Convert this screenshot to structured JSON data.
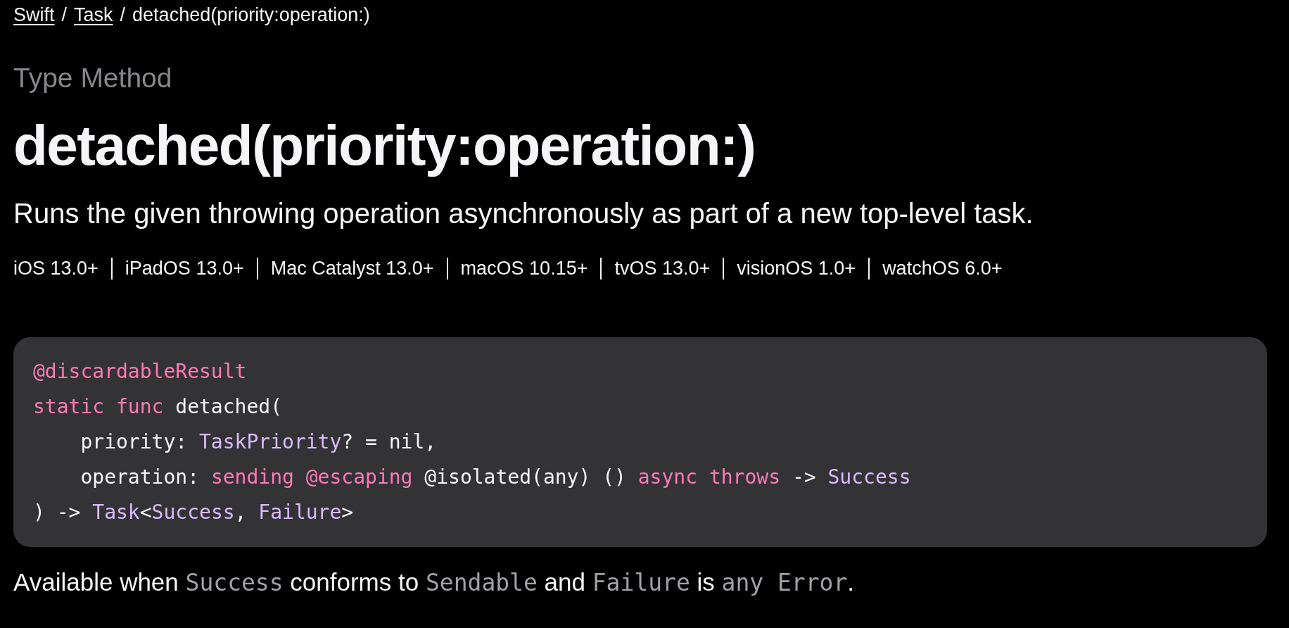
{
  "breadcrumbs": [
    {
      "label": "Swift",
      "link": true
    },
    {
      "label": "Task",
      "link": true
    },
    {
      "label": "detached(priority:operation:)",
      "link": false
    }
  ],
  "breadcrumb_separators": [
    "/",
    "/"
  ],
  "eyebrow": "Type Method",
  "title": "detached(priority:operation:)",
  "abstract": "Runs the given throwing operation asynchronously as part of a new top-level task.",
  "platforms": [
    "iOS 13.0+",
    "iPadOS 13.0+",
    "Mac Catalyst 13.0+",
    "macOS 10.15+",
    "tvOS 13.0+",
    "visionOS 1.0+",
    "watchOS 6.0+"
  ],
  "declaration": [
    [
      {
        "kind": "attribute",
        "text": "@discardableResult"
      }
    ],
    [
      {
        "kind": "keyword",
        "text": "static func"
      },
      {
        "kind": "plain",
        "text": " detached("
      }
    ],
    [
      {
        "kind": "plain",
        "text": "    priority: "
      },
      {
        "kind": "type",
        "text": "TaskPriority"
      },
      {
        "kind": "plain",
        "text": "? = nil,"
      }
    ],
    [
      {
        "kind": "plain",
        "text": "    operation: "
      },
      {
        "kind": "keyword",
        "text": "sending @escaping"
      },
      {
        "kind": "plain",
        "text": " @isolated(any) () "
      },
      {
        "kind": "keyword",
        "text": "async throws"
      },
      {
        "kind": "plain",
        "text": " -> "
      },
      {
        "kind": "type",
        "text": "Success"
      }
    ],
    [
      {
        "kind": "plain",
        "text": ") -> "
      },
      {
        "kind": "type",
        "text": "Task"
      },
      {
        "kind": "plain",
        "text": "<"
      },
      {
        "kind": "type",
        "text": "Success"
      },
      {
        "kind": "plain",
        "text": ", "
      },
      {
        "kind": "type",
        "text": "Failure"
      },
      {
        "kind": "plain",
        "text": ">"
      }
    ]
  ],
  "availability": [
    {
      "kind": "text",
      "text": "Available when "
    },
    {
      "kind": "code",
      "text": "Success"
    },
    {
      "kind": "text",
      "text": " conforms to "
    },
    {
      "kind": "code",
      "text": "Sendable"
    },
    {
      "kind": "text",
      "text": " and "
    },
    {
      "kind": "code",
      "text": "Failure"
    },
    {
      "kind": "text",
      "text": " is "
    },
    {
      "kind": "code",
      "text": "any Error"
    },
    {
      "kind": "text",
      "text": "."
    }
  ]
}
